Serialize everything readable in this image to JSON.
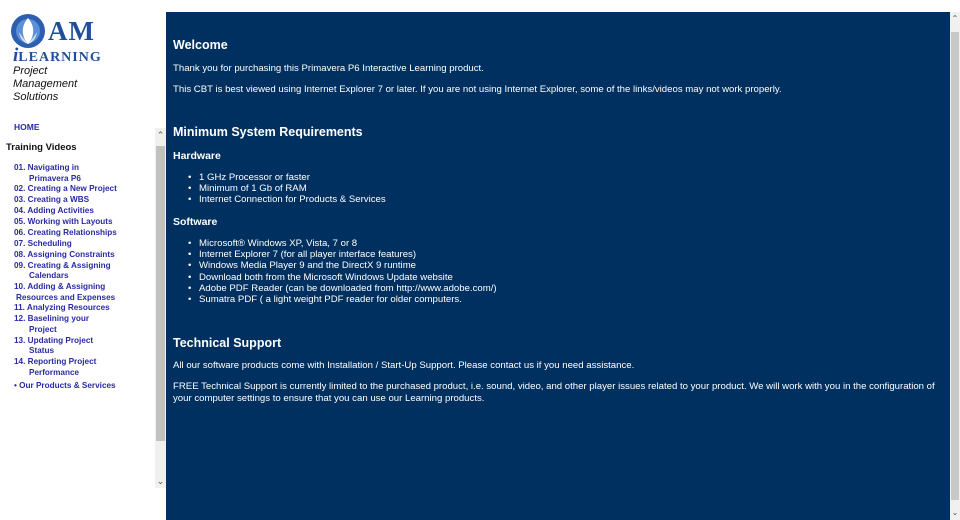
{
  "logo": {
    "brand_am": "AM",
    "brand_i": "i",
    "brand_learning": "LEARNING",
    "tagline_1": "Project",
    "tagline_2": "Management",
    "tagline_3": "Solutions"
  },
  "sidebar": {
    "home_label": "HOME",
    "section_title": "Training Videos",
    "items": [
      {
        "line1": "01. Navigating in",
        "line2": "Primavera P6"
      },
      {
        "line1": "02. Creating a New Project",
        "line2": ""
      },
      {
        "line1": "03. Creating a WBS",
        "line2": ""
      },
      {
        "line1": "04. Adding Activities",
        "line2": ""
      },
      {
        "line1": "05. Working with Layouts",
        "line2": ""
      },
      {
        "line1": "06. Creating Relationships",
        "line2": ""
      },
      {
        "line1": "07. Scheduling",
        "line2": ""
      },
      {
        "line1": "08. Assigning Constraints",
        "line2": ""
      },
      {
        "line1": "09. Creating & Assigning",
        "line2": "Calendars"
      },
      {
        "line1": "10. Adding & Assigning",
        "line2": "Resources and Expenses"
      },
      {
        "line1": "11. Analyzing Resources",
        "line2": ""
      },
      {
        "line1": "12. Baselining your",
        "line2": "Project"
      },
      {
        "line1": "13. Updating Project",
        "line2": "Status"
      },
      {
        "line1": "14. Reporting Project",
        "line2": "Performance"
      }
    ],
    "products_label": "• Our Products & Services"
  },
  "main": {
    "welcome_title": "Welcome",
    "welcome_p1": "Thank you for purchasing this Primavera P6 Interactive Learning product.",
    "welcome_p2": "This CBT is best viewed using Internet Explorer 7 or later. If you are not using Internet Explorer, some of the links/videos may not work properly.",
    "requirements_title": "Minimum System Requirements",
    "hardware_title": "Hardware",
    "hardware_items": [
      "1 GHz Processor or faster",
      "Minimum of 1 Gb of RAM",
      "Internet Connection for Products & Services"
    ],
    "software_title": "Software",
    "software_items": [
      "Microsoft® Windows XP, Vista, 7 or 8",
      "Internet Explorer 7 (for all player interface features)",
      "Windows Media Player 9 and the DirectX 9 runtime",
      "Download both from the Microsoft Windows Update website",
      "Adobe PDF Reader (can be downloaded from http://www.adobe.com/)",
      "Sumatra PDF ( a light weight PDF reader for older computers."
    ],
    "support_title": "Technical Support",
    "support_p1": "All our software products come with Installation / Start-Up Support. Please contact us if you need assistance.",
    "support_p2": "FREE Technical Support is currently limited to the purchased product, i.e. sound, video, and other player issues related to your product. We will work with you in the configuration of your computer settings to ensure that you can use our Learning products."
  },
  "colors": {
    "content_background": "#00305f",
    "link": "#2a2aa5",
    "brand_blue": "#1f4f9a"
  },
  "icons": {
    "scroll_up": "chevron-up-icon",
    "scroll_down": "chevron-down-icon"
  }
}
